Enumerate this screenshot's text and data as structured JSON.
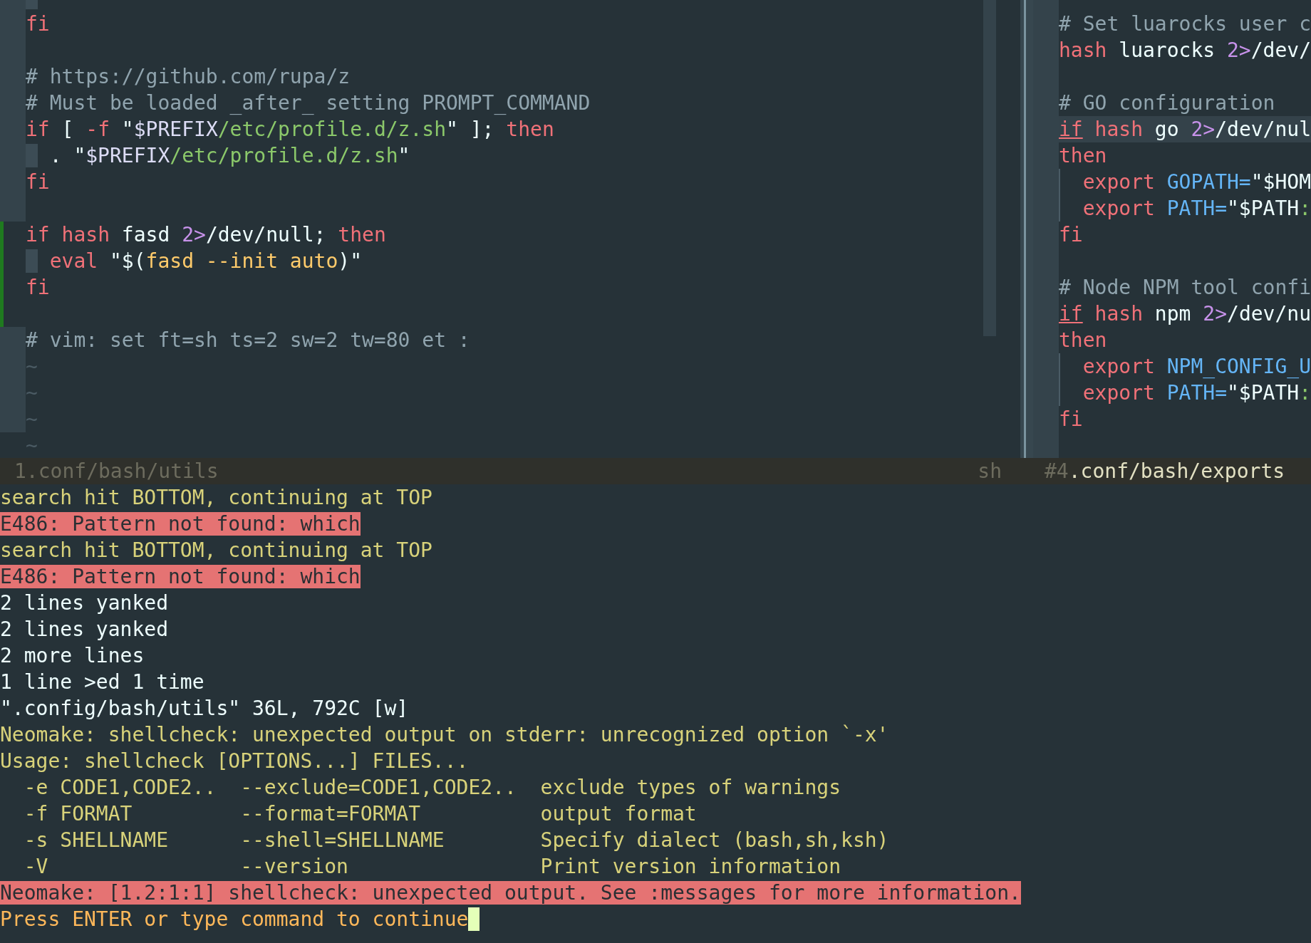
{
  "left_window": {
    "lines": [
      {
        "git_added": false,
        "indent_guide": true
      },
      {
        "git_added": false,
        "tokens": [
          {
            "kind": "keyword",
            "text": "fi"
          }
        ]
      },
      {
        "git_added": false
      },
      {
        "git_added": false,
        "tokens": [
          {
            "kind": "comment",
            "text": "# https://github.com/rupa/z"
          }
        ]
      },
      {
        "git_added": false,
        "tokens": [
          {
            "kind": "comment",
            "text": "# Must be loaded _after_ setting PROMPT_COMMAND"
          }
        ]
      },
      {
        "git_added": false,
        "tokens": [
          {
            "kind": "keyword",
            "text": "if"
          },
          {
            "kind": "plain",
            "text": " [ "
          },
          {
            "kind": "keyword",
            "text": "-f"
          },
          {
            "kind": "plain",
            "text": " \""
          },
          {
            "kind": "variable",
            "text": "$PREFIX"
          },
          {
            "kind": "string",
            "text": "/etc/profile.d/z.sh"
          },
          {
            "kind": "plain",
            "text": "\" ]; "
          },
          {
            "kind": "keyword",
            "text": "then"
          }
        ]
      },
      {
        "git_added": false,
        "indent_guide": true,
        "tokens": [
          {
            "kind": "plain",
            "text": ". \""
          },
          {
            "kind": "variable",
            "text": "$PREFIX"
          },
          {
            "kind": "string",
            "text": "/etc/profile.d/z.sh"
          },
          {
            "kind": "plain",
            "text": "\""
          }
        ]
      },
      {
        "git_added": false,
        "tokens": [
          {
            "kind": "keyword",
            "text": "fi"
          }
        ]
      },
      {
        "git_added": false
      },
      {
        "git_added": true,
        "tokens": [
          {
            "kind": "keyword",
            "text": "if hash"
          },
          {
            "kind": "plain",
            "text": " fasd "
          },
          {
            "kind": "number",
            "text": "2>"
          },
          {
            "kind": "plain",
            "text": "/dev/null; "
          },
          {
            "kind": "keyword",
            "text": "then"
          }
        ]
      },
      {
        "git_added": true,
        "indent_guide": true,
        "tokens": [
          {
            "kind": "keyword",
            "text": "eval"
          },
          {
            "kind": "plain",
            "text": " \"$("
          },
          {
            "kind": "special",
            "text": "fasd --init auto"
          },
          {
            "kind": "plain",
            "text": ")\""
          }
        ]
      },
      {
        "git_added": true,
        "tokens": [
          {
            "kind": "keyword",
            "text": "fi"
          }
        ]
      },
      {
        "git_added": true
      },
      {
        "git_added": false,
        "tokens": [
          {
            "kind": "comment",
            "text": "# vim: set ft=sh ts=2 sw=2 tw=80 et :"
          }
        ]
      },
      {
        "git_added": false,
        "tokens": [
          {
            "kind": "filler",
            "text": "~"
          }
        ]
      },
      {
        "git_added": false,
        "tokens": [
          {
            "kind": "filler",
            "text": "~"
          }
        ]
      },
      {
        "git_added": false,
        "tokens": [
          {
            "kind": "filler",
            "text": "~"
          }
        ]
      },
      {
        "git_added": false,
        "tokens": [
          {
            "kind": "filler",
            "text": "~"
          }
        ]
      }
    ]
  },
  "right_window": {
    "lines": [
      {
        "cursorline": false
      },
      {
        "cursorline": false,
        "tokens": [
          {
            "kind": "comment",
            "text": "# Set luarocks user c"
          }
        ]
      },
      {
        "cursorline": false,
        "tokens": [
          {
            "kind": "keyword",
            "text": "hash"
          },
          {
            "kind": "plain",
            "text": " luarocks "
          },
          {
            "kind": "number",
            "text": "2>"
          },
          {
            "kind": "plain",
            "text": "/dev/"
          }
        ]
      },
      {
        "cursorline": false
      },
      {
        "cursorline": false,
        "tokens": [
          {
            "kind": "comment",
            "text": "# GO configuration"
          }
        ]
      },
      {
        "cursorline": true,
        "tokens": [
          {
            "kind": "match",
            "text": "if"
          },
          {
            "kind": "keyword",
            "text": " hash"
          },
          {
            "kind": "plain",
            "text": " go "
          },
          {
            "kind": "number",
            "text": "2>"
          },
          {
            "kind": "plain",
            "text": "/dev/nul"
          }
        ]
      },
      {
        "cursorline": false,
        "tokens": [
          {
            "kind": "keyword",
            "text": "then"
          }
        ]
      },
      {
        "cursorline": false,
        "indent_guide": true,
        "tokens": [
          {
            "kind": "keyword",
            "text": "export"
          },
          {
            "kind": "ident",
            "text": " GOPATH="
          },
          {
            "kind": "plain",
            "text": "\"$HOM"
          }
        ]
      },
      {
        "cursorline": false,
        "indent_guide": true,
        "tokens": [
          {
            "kind": "keyword",
            "text": "export"
          },
          {
            "kind": "ident",
            "text": " PATH="
          },
          {
            "kind": "plain",
            "text": "\"$PATH"
          },
          {
            "kind": "string",
            "text": ":"
          }
        ]
      },
      {
        "cursorline": false,
        "tokens": [
          {
            "kind": "keyword",
            "text": "fi"
          }
        ]
      },
      {
        "cursorline": false
      },
      {
        "cursorline": false,
        "tokens": [
          {
            "kind": "comment",
            "text": "# Node NPM tool confi"
          }
        ]
      },
      {
        "cursorline": false,
        "tokens": [
          {
            "kind": "match",
            "text": "if"
          },
          {
            "kind": "keyword",
            "text": " hash"
          },
          {
            "kind": "plain",
            "text": " npm "
          },
          {
            "kind": "number",
            "text": "2>"
          },
          {
            "kind": "plain",
            "text": "/dev/nu"
          }
        ]
      },
      {
        "cursorline": false,
        "tokens": [
          {
            "kind": "keyword",
            "text": "then"
          }
        ]
      },
      {
        "cursorline": false,
        "indent_guide": true,
        "tokens": [
          {
            "kind": "keyword",
            "text": "export"
          },
          {
            "kind": "ident",
            "text": " NPM_CONFIG_U"
          }
        ]
      },
      {
        "cursorline": false,
        "indent_guide": true,
        "tokens": [
          {
            "kind": "keyword",
            "text": "export"
          },
          {
            "kind": "ident",
            "text": " PATH="
          },
          {
            "kind": "plain",
            "text": "\"$PATH"
          },
          {
            "kind": "string",
            "text": ":"
          }
        ]
      },
      {
        "cursorline": false,
        "tokens": [
          {
            "kind": "keyword",
            "text": "fi"
          }
        ]
      },
      {
        "cursorline": false
      }
    ]
  },
  "status_lines": [
    {
      "number": "1",
      "path": ".conf/bash/utils",
      "filetype": "sh",
      "active": false
    },
    {
      "number": "#4",
      "path": ".conf/bash/exports",
      "active": true
    }
  ],
  "messages": [
    {
      "kind": "warning",
      "text": "search hit BOTTOM, continuing at TOP",
      "cursor": false
    },
    {
      "kind": "error",
      "text": "E486: Pattern not found: which",
      "cursor": false
    },
    {
      "kind": "warning",
      "text": "search hit BOTTOM, continuing at TOP",
      "cursor": false
    },
    {
      "kind": "error",
      "text": "E486: Pattern not found: which",
      "cursor": false
    },
    {
      "kind": "info",
      "text": "2 lines yanked",
      "cursor": false
    },
    {
      "kind": "info",
      "text": "2 lines yanked",
      "cursor": false
    },
    {
      "kind": "info",
      "text": "2 more lines",
      "cursor": false
    },
    {
      "kind": "info",
      "text": "1 line >ed 1 time",
      "cursor": false
    },
    {
      "kind": "info",
      "text": "\".config/bash/utils\" 36L, 792C [w]",
      "cursor": false
    },
    {
      "kind": "warning",
      "text": "Neomake: shellcheck: unexpected output on stderr: unrecognized option `-x'",
      "cursor": false
    },
    {
      "kind": "warning",
      "text": "Usage: shellcheck [OPTIONS...] FILES...",
      "cursor": false
    },
    {
      "kind": "warning",
      "text": "  -e CODE1,CODE2..  --exclude=CODE1,CODE2..  exclude types of warnings",
      "cursor": false
    },
    {
      "kind": "warning",
      "text": "  -f FORMAT         --format=FORMAT          output format",
      "cursor": false
    },
    {
      "kind": "warning",
      "text": "  -s SHELLNAME      --shell=SHELLNAME        Specify dialect (bash,sh,ksh)",
      "cursor": false
    },
    {
      "kind": "warning",
      "text": "  -V                --version                Print version information",
      "cursor": false
    },
    {
      "kind": "error",
      "text": "Neomake: [1.2:1:1] shellcheck: unexpected output. See :messages for more information.",
      "cursor": false
    },
    {
      "kind": "prompt",
      "text": "Press ENTER or type command to continue",
      "cursor": true
    }
  ]
}
